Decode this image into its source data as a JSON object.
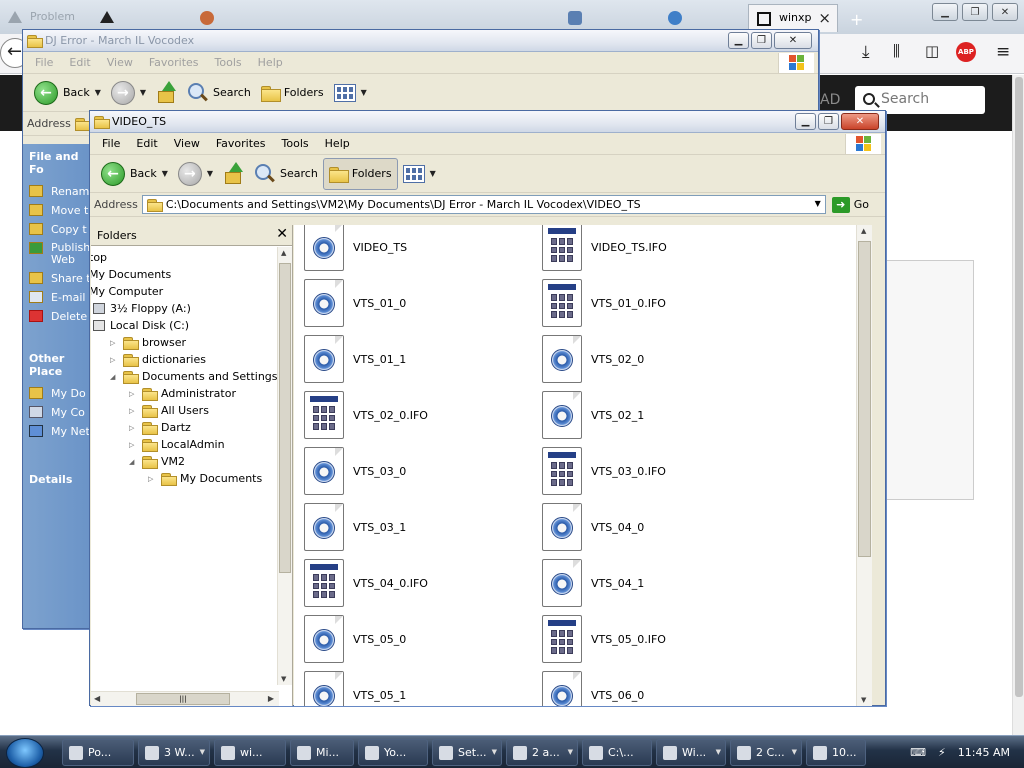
{
  "browser": {
    "tabs": [
      {
        "label": "Problem",
        "icon": "warning-icon"
      },
      {
        "label": "...",
        "icon": "arrow-icon"
      },
      {
        "label": "...",
        "icon": "glove-icon"
      },
      {
        "label": "...",
        "icon": "blank-icon"
      },
      {
        "label": "...",
        "icon": "blank-icon"
      },
      {
        "label": "...",
        "icon": "blank-icon"
      },
      {
        "label": "...",
        "icon": "shield-icon"
      },
      {
        "label": "...",
        "icon": "globe-icon"
      }
    ],
    "active_tab": "winxp",
    "new_tab_label": "+",
    "search_placeholder": "Search",
    "adblock_label": "ABP",
    "page_fragment": "AD"
  },
  "back_window": {
    "title": "DJ Error - March IL Vocodex",
    "menu": [
      "File",
      "Edit",
      "View",
      "Favorites",
      "Tools",
      "Help"
    ],
    "toolbar": {
      "back": "Back",
      "search": "Search",
      "folders": "Folders"
    },
    "address_label": "Address",
    "tasks": {
      "file_folder_header": "File and Fo",
      "file_items": [
        "Renam",
        "Move t",
        "Copy t",
        "Publish Web",
        "Share t",
        "E-mail",
        "Delete"
      ],
      "other_header": "Other Place",
      "other_items": [
        "My Do",
        "My Co",
        "My Net"
      ],
      "details_header": "Details"
    }
  },
  "front_window": {
    "title": "VIDEO_TS",
    "menu": [
      "File",
      "Edit",
      "View",
      "Favorites",
      "Tools",
      "Help"
    ],
    "toolbar": {
      "back": "Back",
      "search": "Search",
      "folders": "Folders"
    },
    "address_label": "Address",
    "address_value": "C:\\Documents and Settings\\VM2\\My Documents\\DJ Error - March IL Vocodex\\VIDEO_TS",
    "go_label": "Go",
    "folders_header": "Folders",
    "tree": [
      {
        "label": "top",
        "indent": 0,
        "twisty": "",
        "icon": "none"
      },
      {
        "label": "My Documents",
        "indent": 0,
        "twisty": "",
        "icon": "none"
      },
      {
        "label": "My Computer",
        "indent": 0,
        "twisty": "",
        "icon": "none"
      },
      {
        "label": "3½ Floppy (A:)",
        "indent": 1,
        "twisty": "",
        "icon": "floppy"
      },
      {
        "label": "Local Disk (C:)",
        "indent": 1,
        "twisty": "",
        "icon": "disk"
      },
      {
        "label": "browser",
        "indent": 2,
        "twisty": "▷",
        "icon": "folder"
      },
      {
        "label": "dictionaries",
        "indent": 2,
        "twisty": "▷",
        "icon": "folder"
      },
      {
        "label": "Documents and Settings",
        "indent": 2,
        "twisty": "◢",
        "icon": "folder"
      },
      {
        "label": "Administrator",
        "indent": 3,
        "twisty": "▷",
        "icon": "folder"
      },
      {
        "label": "All Users",
        "indent": 3,
        "twisty": "▷",
        "icon": "folder"
      },
      {
        "label": "Dartz",
        "indent": 3,
        "twisty": "▷",
        "icon": "folder"
      },
      {
        "label": "LocalAdmin",
        "indent": 3,
        "twisty": "▷",
        "icon": "folder"
      },
      {
        "label": "VM2",
        "indent": 3,
        "twisty": "◢",
        "icon": "folder"
      },
      {
        "label": "My Documents",
        "indent": 4,
        "twisty": "▷",
        "icon": "folder"
      }
    ],
    "files": [
      {
        "name": "VIDEO_TS",
        "type": "vid"
      },
      {
        "name": "VIDEO_TS.IFO",
        "type": "ifo"
      },
      {
        "name": "VTS_01_0",
        "type": "vid"
      },
      {
        "name": "VTS_01_0.IFO",
        "type": "ifo"
      },
      {
        "name": "VTS_01_1",
        "type": "vid"
      },
      {
        "name": "VTS_02_0",
        "type": "vid"
      },
      {
        "name": "VTS_02_0.IFO",
        "type": "ifo"
      },
      {
        "name": "VTS_02_1",
        "type": "vid"
      },
      {
        "name": "VTS_03_0",
        "type": "vid"
      },
      {
        "name": "VTS_03_0.IFO",
        "type": "ifo"
      },
      {
        "name": "VTS_03_1",
        "type": "vid"
      },
      {
        "name": "VTS_04_0",
        "type": "vid"
      },
      {
        "name": "VTS_04_0.IFO",
        "type": "ifo"
      },
      {
        "name": "VTS_04_1",
        "type": "vid"
      },
      {
        "name": "VTS_05_0",
        "type": "vid"
      },
      {
        "name": "VTS_05_0.IFO",
        "type": "ifo"
      },
      {
        "name": "VTS_05_1",
        "type": "vid"
      },
      {
        "name": "VTS_06_0",
        "type": "vid"
      }
    ]
  },
  "taskbar": {
    "tasks": [
      {
        "label": "Po...",
        "icon": "plus-icon"
      },
      {
        "label": "3 W...",
        "icon": "folder-icon"
      },
      {
        "label": "wi...",
        "icon": "eye-icon"
      },
      {
        "label": "Mi...",
        "icon": "star-icon"
      },
      {
        "label": "Yo...",
        "icon": "window-icon"
      },
      {
        "label": "Set...",
        "icon": "glove-icon"
      },
      {
        "label": "2 a...",
        "icon": "glove-icon"
      },
      {
        "label": "C:\\...",
        "icon": "console-icon"
      },
      {
        "label": "Wi...",
        "icon": "media-icon"
      },
      {
        "label": "2 C...",
        "icon": "globe-icon"
      },
      {
        "label": "10...",
        "icon": "console-icon"
      }
    ],
    "clock": "11:45 AM"
  },
  "colors": {
    "xp_blue": "#4a6aa2",
    "tasks_blue": "#6b94c8",
    "taskbar": "#223247"
  }
}
